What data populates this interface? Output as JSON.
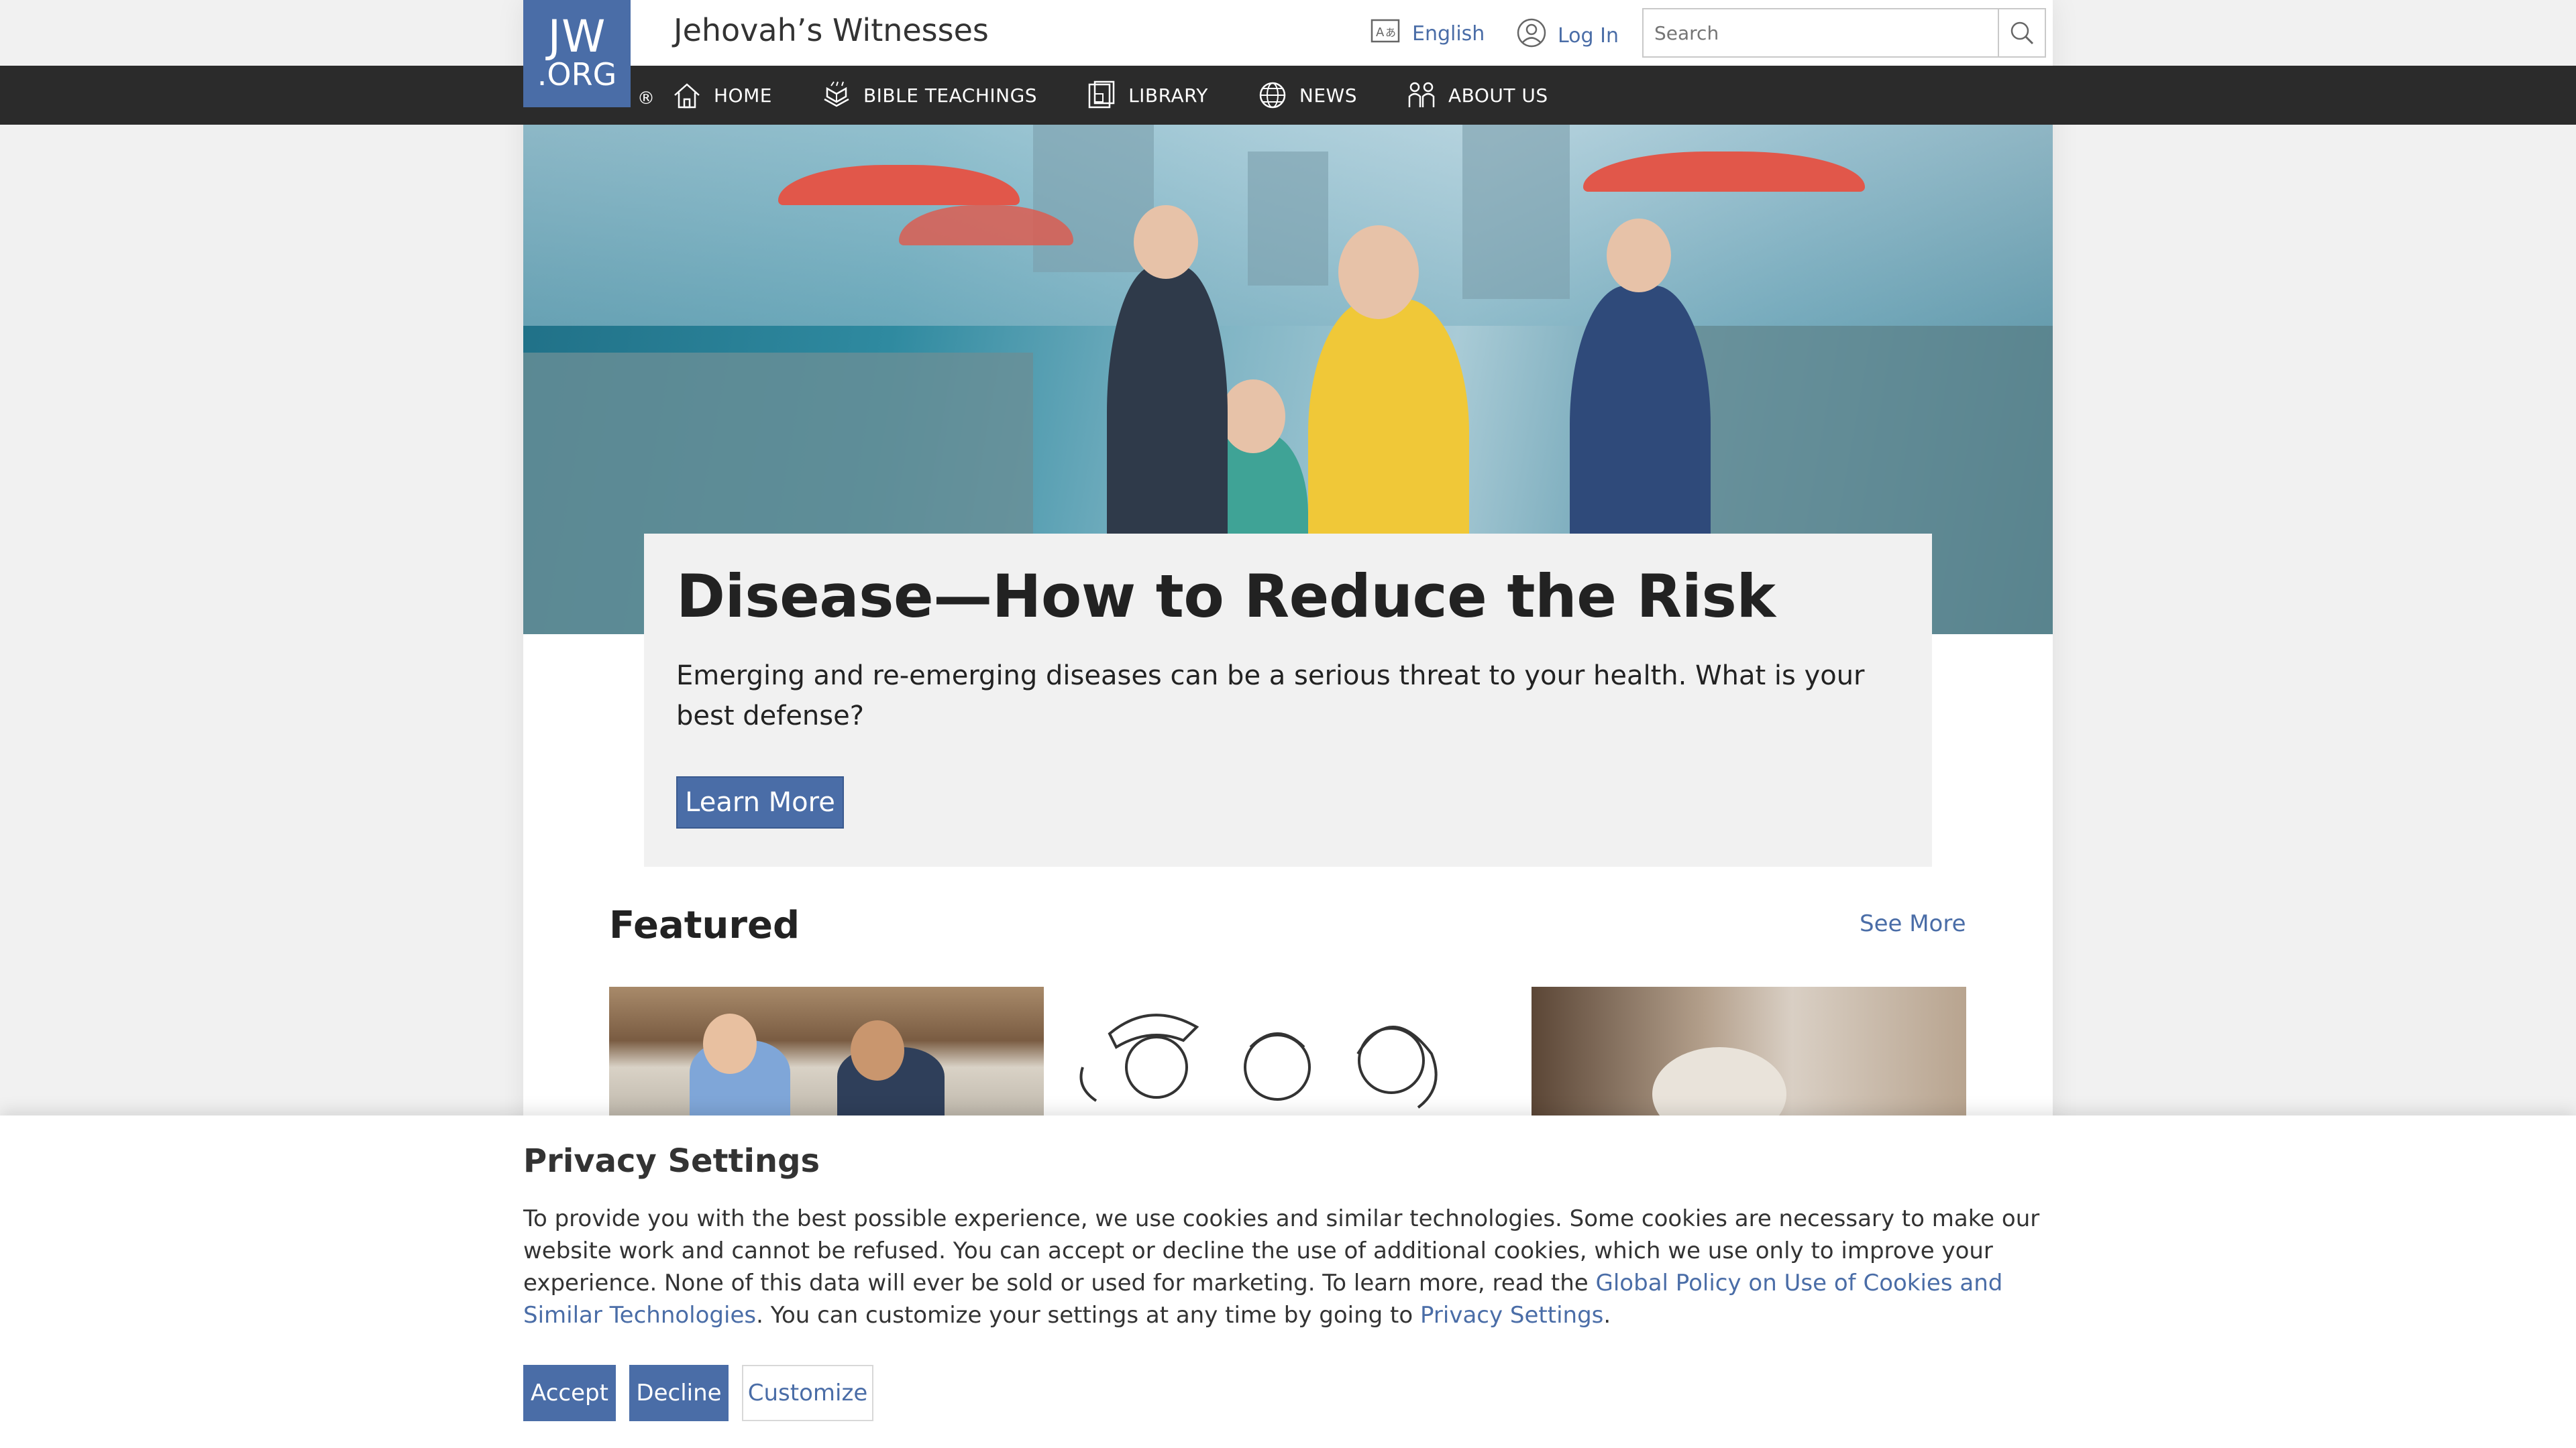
{
  "header": {
    "logo_line1": "JW",
    "logo_line2": ".ORG",
    "registered": "®",
    "site_title": "Jehovah’s Witnesses",
    "language": "English",
    "login": "Log In",
    "search_placeholder": "Search"
  },
  "nav": {
    "items": [
      {
        "label": "HOME",
        "icon": "home-icon"
      },
      {
        "label": "BIBLE TEACHINGS",
        "icon": "bible-teachings-icon"
      },
      {
        "label": "LIBRARY",
        "icon": "library-icon"
      },
      {
        "label": "NEWS",
        "icon": "globe-icon"
      },
      {
        "label": "ABOUT US",
        "icon": "people-icon"
      }
    ]
  },
  "hero": {
    "title": "Disease—How to Reduce the Risk",
    "description": "Emerging and re-emerging diseases can be a serious threat to your health. What is your best defense?",
    "button": "Learn More"
  },
  "featured": {
    "title": "Featured",
    "see_more": "See More"
  },
  "privacy": {
    "title": "Privacy Settings",
    "text_before": "To provide you with the best possible experience, we use cookies and similar technologies. Some cookies are necessary to make our website work and cannot be refused. You can accept or decline the use of additional cookies, which we use only to improve your experience. None of this data will ever be sold or used for marketing. To learn more, read the ",
    "link1": "Global Policy on Use of Cookies and Similar Technologies",
    "text_middle": ". You can customize your settings at any time by going to ",
    "link2": "Privacy Settings",
    "text_after": ".",
    "accept": "Accept",
    "decline": "Decline",
    "customize": "Customize"
  },
  "colors": {
    "brand": "#4a6da7",
    "nav_bg": "#2b2b2b"
  }
}
